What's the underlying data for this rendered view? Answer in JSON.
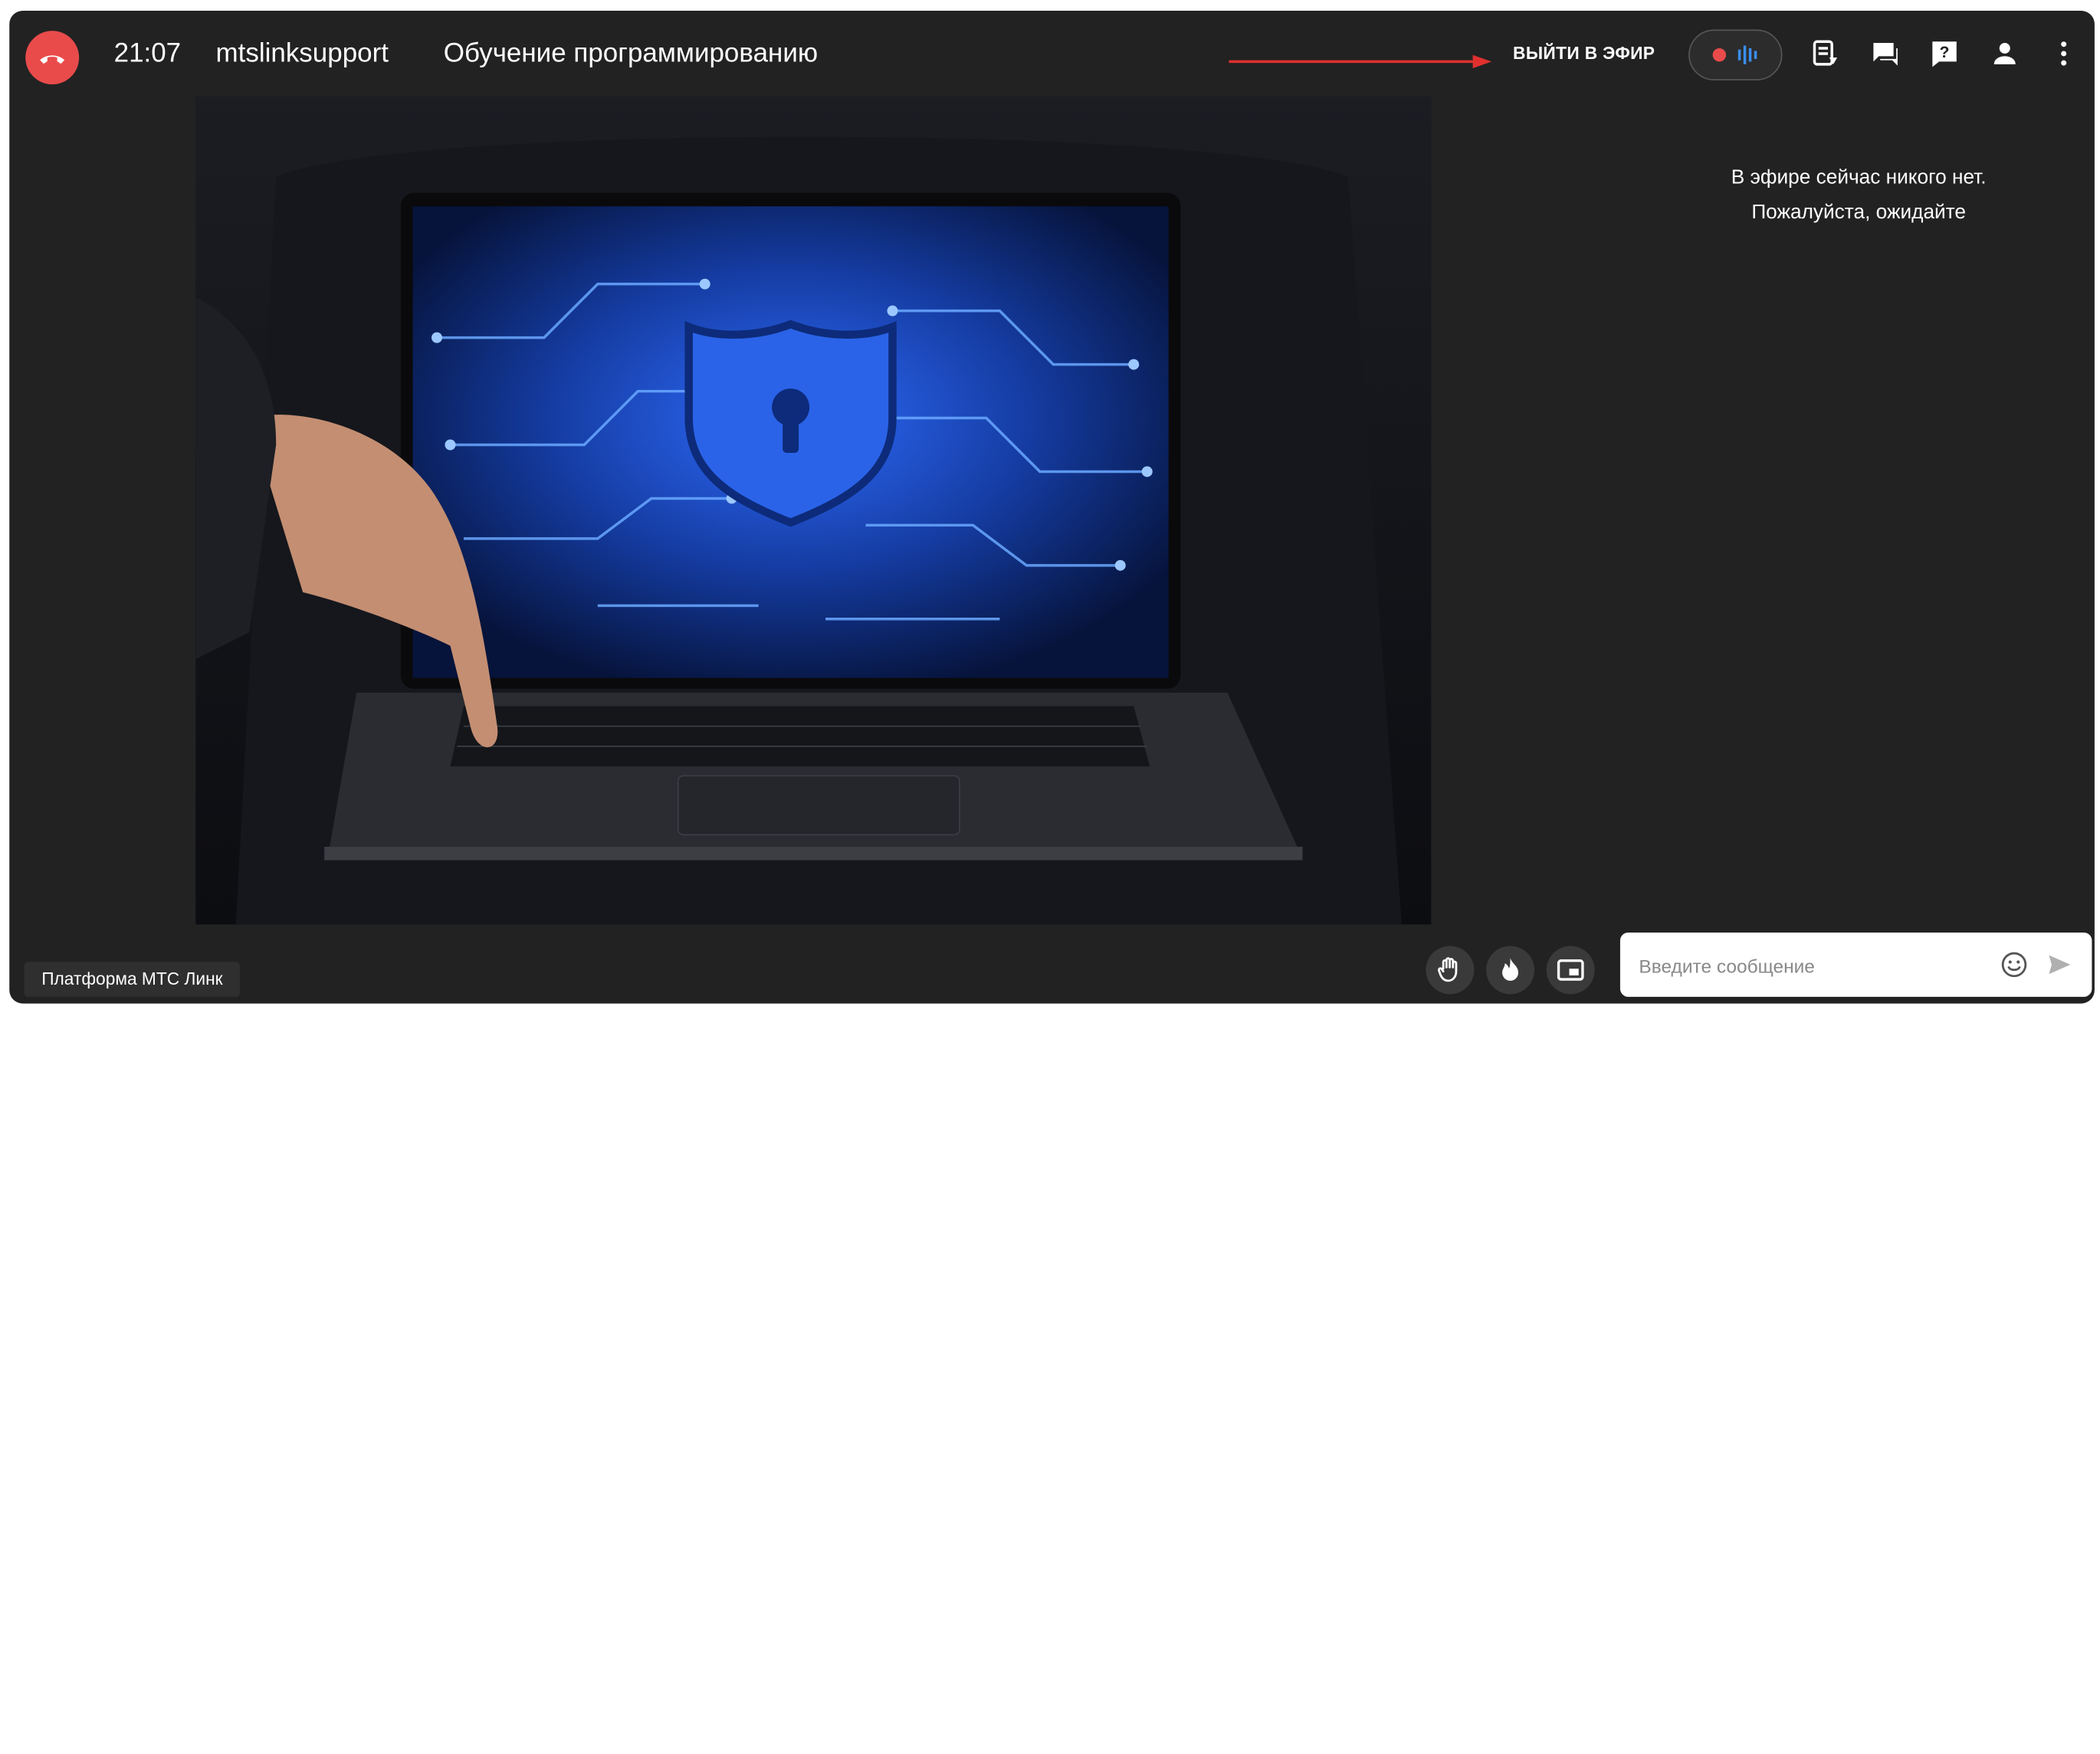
{
  "header": {
    "time": "21:07",
    "organization": "mtslinksupport",
    "title": "Обучение программированию",
    "go_live_label": "ВЫЙТИ В ЭФИР"
  },
  "toolbar_icons": [
    "notes-icon",
    "chat-icon",
    "question-icon",
    "participants-icon",
    "more-icon"
  ],
  "sidebar": {
    "status_line1": "В эфире сейчас никого нет.",
    "status_line2": "Пожалуйста, ожидайте"
  },
  "footer": {
    "platform_label": "Платформа МТС Линк",
    "message_placeholder": "Введите сообщение"
  },
  "colors": {
    "background": "#222222",
    "accent_red": "#e94b4b",
    "screen_blue": "#1d4fd6"
  }
}
